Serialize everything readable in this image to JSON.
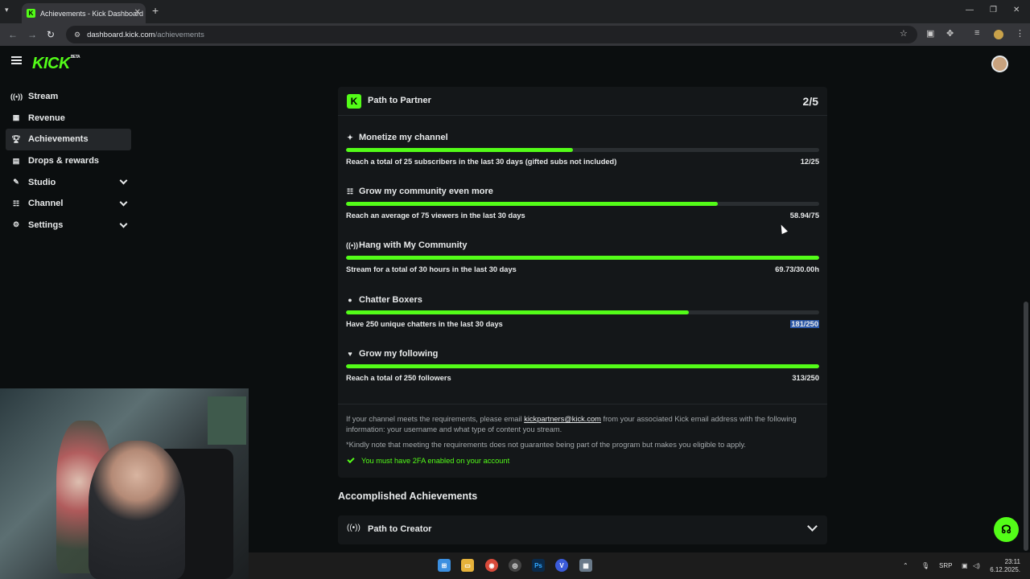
{
  "browser": {
    "tab_title": "Achievements - Kick Dashboard",
    "url_host": "dashboard.kick.com",
    "url_path": "/achievements"
  },
  "header": {
    "logo": "KICK",
    "logo_badge": "BETA"
  },
  "sidebar": {
    "items": [
      {
        "label": "Stream",
        "icon": "broadcast-icon"
      },
      {
        "label": "Revenue",
        "icon": "chart-icon"
      },
      {
        "label": "Achievements",
        "icon": "trophy-icon"
      },
      {
        "label": "Drops & rewards",
        "icon": "gift-icon"
      },
      {
        "label": "Studio",
        "icon": "palette-icon"
      },
      {
        "label": "Channel",
        "icon": "users-icon"
      },
      {
        "label": "Settings",
        "icon": "gear-icon"
      }
    ]
  },
  "path_to_partner": {
    "title": "Path to Partner",
    "count": "2/5",
    "goals": [
      {
        "title": "Monetize my channel",
        "desc": "Reach a total of 25 subscribers in the last 30 days (gifted subs not included)",
        "value": "12/25",
        "progress": 0.48
      },
      {
        "title": "Grow my community even more",
        "desc": "Reach an average of 75 viewers in the last 30 days",
        "value": "58.94/75",
        "progress": 0.786
      },
      {
        "title": "Hang with My Community",
        "desc": "Stream for a total of 30 hours in the last 30 days",
        "value": "69.73/30.00h",
        "progress": 1.0
      },
      {
        "title": "Chatter Boxers",
        "desc": "Have 250 unique chatters in the last 30 days",
        "value": "181/250",
        "progress": 0.724
      },
      {
        "title": "Grow my following",
        "desc": "Reach a total of 250 followers",
        "value": "313/250",
        "progress": 1.0
      }
    ],
    "note_prefix": "If your channel meets the requirements, please email",
    "note_email": "kickpartners@kick.com",
    "note_suffix": "from your associated Kick email address with the following information: your username and what type of content you stream.",
    "note_disclaimer": "*Kindly note that meeting the requirements does not guarantee being part of the program but makes you eligible to apply.",
    "requirement": "You must have 2FA enabled on your account"
  },
  "accomplished": {
    "heading": "Accomplished Achievements",
    "items": [
      {
        "title": "Path to Creator"
      }
    ]
  },
  "taskbar": {
    "lang": "SRP",
    "time": "23:11",
    "date": "6.12.2025."
  },
  "colors": {
    "accent": "#53fc18",
    "background": "#0b0e0f",
    "card": "#141719"
  }
}
